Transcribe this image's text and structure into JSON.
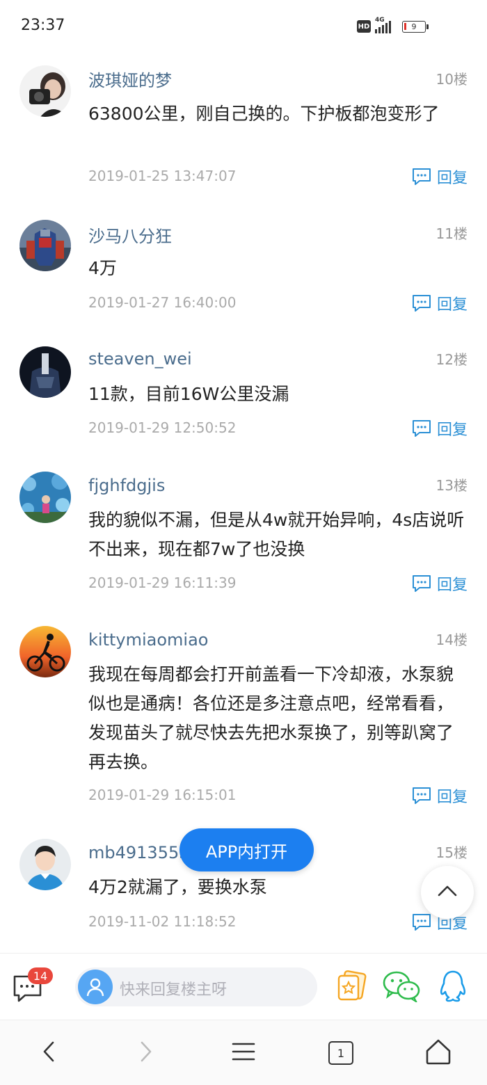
{
  "status_bar": {
    "time": "23:37",
    "hd_label": "HD",
    "network_label": "4G",
    "battery_level": "9"
  },
  "comments": [
    {
      "username": "波琪娅的梦",
      "floor": "10楼",
      "content": "63800公里，刚自己换的。下护板都泡变形了",
      "time": "2019-01-25 13:47:07",
      "reply_label": "回复"
    },
    {
      "username": "沙马八分狂",
      "floor": "11楼",
      "content": "4万",
      "time": "2019-01-27 16:40:00",
      "reply_label": "回复"
    },
    {
      "username": "steaven_wei",
      "floor": "12楼",
      "content": "11款，目前16W公里没漏",
      "time": "2019-01-29 12:50:52",
      "reply_label": "回复"
    },
    {
      "username": "fjghfdgjis",
      "floor": "13楼",
      "content": "我的貌似不漏，但是从4w就开始异响，4s店说听不出来，现在都7w了也没换",
      "time": "2019-01-29 16:11:39",
      "reply_label": "回复"
    },
    {
      "username": "kittymiaomiao",
      "floor": "14楼",
      "content": "我现在每周都会打开前盖看一下冷却液，水泵貌似也是通病！各位还是多注意点吧，经常看看，发现苗头了就尽快去先把水泵换了，别等趴窝了再去换。",
      "time": "2019-01-29 16:15:01",
      "reply_label": "回复"
    },
    {
      "username": "mb4913553",
      "floor": "15楼",
      "content": "4万2就漏了，要换水泵",
      "time": "2019-11-02 11:18:52",
      "reply_label": "回复"
    }
  ],
  "floating": {
    "app_open_label": "APP内打开"
  },
  "reply_bar": {
    "message_count": "14",
    "placeholder": "快来回复楼主呀"
  },
  "colors": {
    "accent": "#2a8fd5",
    "button_blue": "#1c7ff0",
    "badge_red": "#e9473c",
    "username": "#4a6c8c",
    "wechat_green": "#2dbb4b",
    "qq_blue": "#1a9be8",
    "star_orange": "#f5a623"
  },
  "icons": {
    "message": "chat-bubble-icon",
    "reply": "comment-dots-icon",
    "collect": "star-card-icon",
    "wechat": "wechat-icon",
    "qq": "qq-penguin-icon",
    "scroll_top": "chevron-up-icon",
    "nav_back": "chevron-left-icon",
    "nav_forward": "chevron-right-icon",
    "nav_menu": "hamburger-icon",
    "nav_tabs": "tabs-icon",
    "nav_home": "home-icon"
  },
  "nav": {
    "tab_count": "1"
  }
}
